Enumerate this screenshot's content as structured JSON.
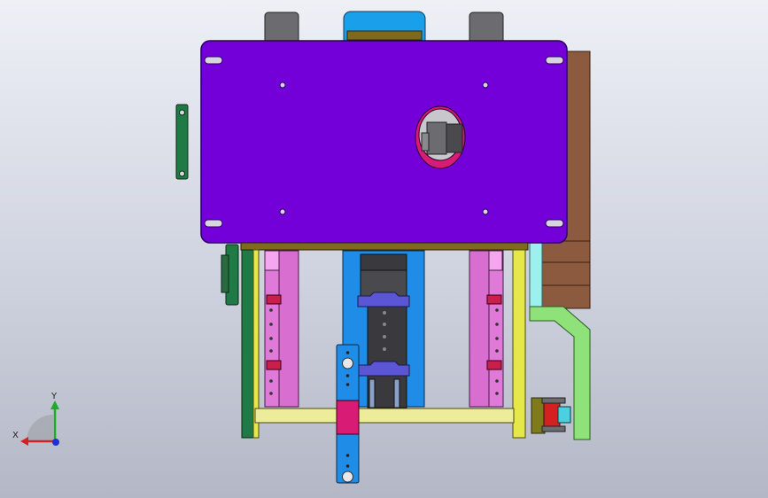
{
  "viewport": {
    "background_top": "#eef0f6",
    "background_bottom": "#b4b8c6"
  },
  "model": {
    "colors": {
      "top_plate": "#7400d9",
      "top_plate_outline": "#2a0060",
      "top_block_blue": "#1aa0ea",
      "side_post_gray": "#6c6c70",
      "gold_strip": "#7d6a1e",
      "bracket_green": "#1f7a45",
      "column_pink": "#e07ad8",
      "column_pink_light": "#f6a6ee",
      "slider_red": "#c81f4d",
      "center_column_blue": "#1f8de8",
      "center_block_gray": "#4a4a4e",
      "clamp_blue_purple": "#5a56d6",
      "yellow_frame": "#e6e84a",
      "yellow_bar": "#ecec9a",
      "lime_bracket": "#8fe27a",
      "brown_block": "#8c5a3e",
      "cyan_spacer": "#9ef0ee",
      "olive_bolt": "#7f7b1d",
      "hole_fill": "#d8d4e0",
      "magenta_ring": "#d81b74"
    }
  },
  "triad": {
    "x_label": "X",
    "y_label": "Y",
    "x_axis_color": "#d42020",
    "y_axis_color": "#1faa2a",
    "z_axis_color": "#2030d0"
  }
}
